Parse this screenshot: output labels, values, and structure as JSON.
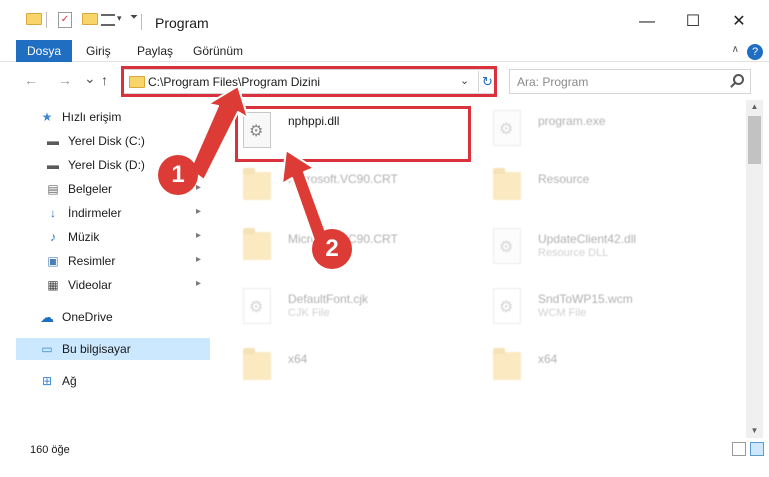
{
  "window": {
    "title": "Program",
    "minimize": "—",
    "maximize": "☐",
    "close": "✕"
  },
  "ribbon": {
    "tabs": [
      "Dosya",
      "Giriş",
      "Paylaş",
      "Görünüm"
    ],
    "help": "?",
    "collapse": "∧"
  },
  "nav": {
    "back": "←",
    "forward": "→",
    "recent": "⌄",
    "up": "↑",
    "address": "C:\\Program Files\\Program Dizini",
    "dropdown": "⌄",
    "refresh": "↻",
    "search_placeholder": "Ara: Program"
  },
  "sidebar": {
    "items": [
      {
        "label": "Hızlı erişim",
        "icon": "star-icon",
        "glyph": "★",
        "color": "#3b87d6"
      },
      {
        "label": "Yerel Disk (C:)",
        "icon": "drive-icon",
        "glyph": "▬",
        "color": "#5a5a5a"
      },
      {
        "label": "Yerel Disk (D:)",
        "icon": "drive-icon",
        "glyph": "▬",
        "color": "#5a5a5a"
      },
      {
        "label": "Belgeler",
        "icon": "documents-icon",
        "glyph": "▤",
        "color": "#6a6a6a"
      },
      {
        "label": "İndirmeler",
        "icon": "download-icon",
        "glyph": "↓",
        "color": "#2a74c9"
      },
      {
        "label": "Müzik",
        "icon": "music-icon",
        "glyph": "♪",
        "color": "#2a74c9"
      },
      {
        "label": "Resimler",
        "icon": "pictures-icon",
        "glyph": "▣",
        "color": "#4a7fb5"
      },
      {
        "label": "Videolar",
        "icon": "videos-icon",
        "glyph": "▦",
        "color": "#4a4a4a"
      },
      {
        "label": "OneDrive",
        "icon": "cloud-icon",
        "glyph": "☁",
        "color": "#1f6ec2"
      },
      {
        "label": "Bu bilgisayar",
        "icon": "computer-icon",
        "glyph": "▭",
        "color": "#3b87d6"
      },
      {
        "label": "Ağ",
        "icon": "network-icon",
        "glyph": "⊞",
        "color": "#3b87d6"
      }
    ],
    "pin": "📌"
  },
  "files": [
    {
      "name": "nphppi.dll",
      "sub": "",
      "icon": "dll-file-icon",
      "kind": "doc",
      "faded": false
    },
    {
      "name": "program.exe",
      "sub": "",
      "icon": "exe-file-icon",
      "kind": "doc",
      "faded": true
    },
    {
      "name": "Microsoft.VC90.CRT",
      "sub": "",
      "icon": "folder-icon",
      "kind": "folder",
      "faded": true
    },
    {
      "name": "Resource",
      "sub": "",
      "icon": "folder-icon",
      "kind": "folder",
      "faded": true
    },
    {
      "name": "Microsoft.VC90.CRT",
      "sub": "",
      "icon": "folder-icon",
      "kind": "folder",
      "faded": true
    },
    {
      "name": "UpdateClient42.dll",
      "sub": "Resource DLL",
      "icon": "dll-file-icon",
      "kind": "doc",
      "faded": true
    },
    {
      "name": "DefaultFont.cjk",
      "sub": "CJK File",
      "icon": "file-icon",
      "kind": "doc",
      "faded": true
    },
    {
      "name": "SndToWP15.wcm",
      "sub": "WCM File",
      "icon": "file-icon",
      "kind": "doc",
      "faded": true
    },
    {
      "name": "x64",
      "sub": "",
      "icon": "folder-icon",
      "kind": "folder",
      "faded": true
    },
    {
      "name": "x64",
      "sub": "",
      "icon": "folder-icon",
      "kind": "folder",
      "faded": true
    }
  ],
  "status": {
    "count": "160 öğe"
  },
  "annotations": {
    "badge1": "1",
    "badge2": "2",
    "color": "#dd3b35"
  }
}
